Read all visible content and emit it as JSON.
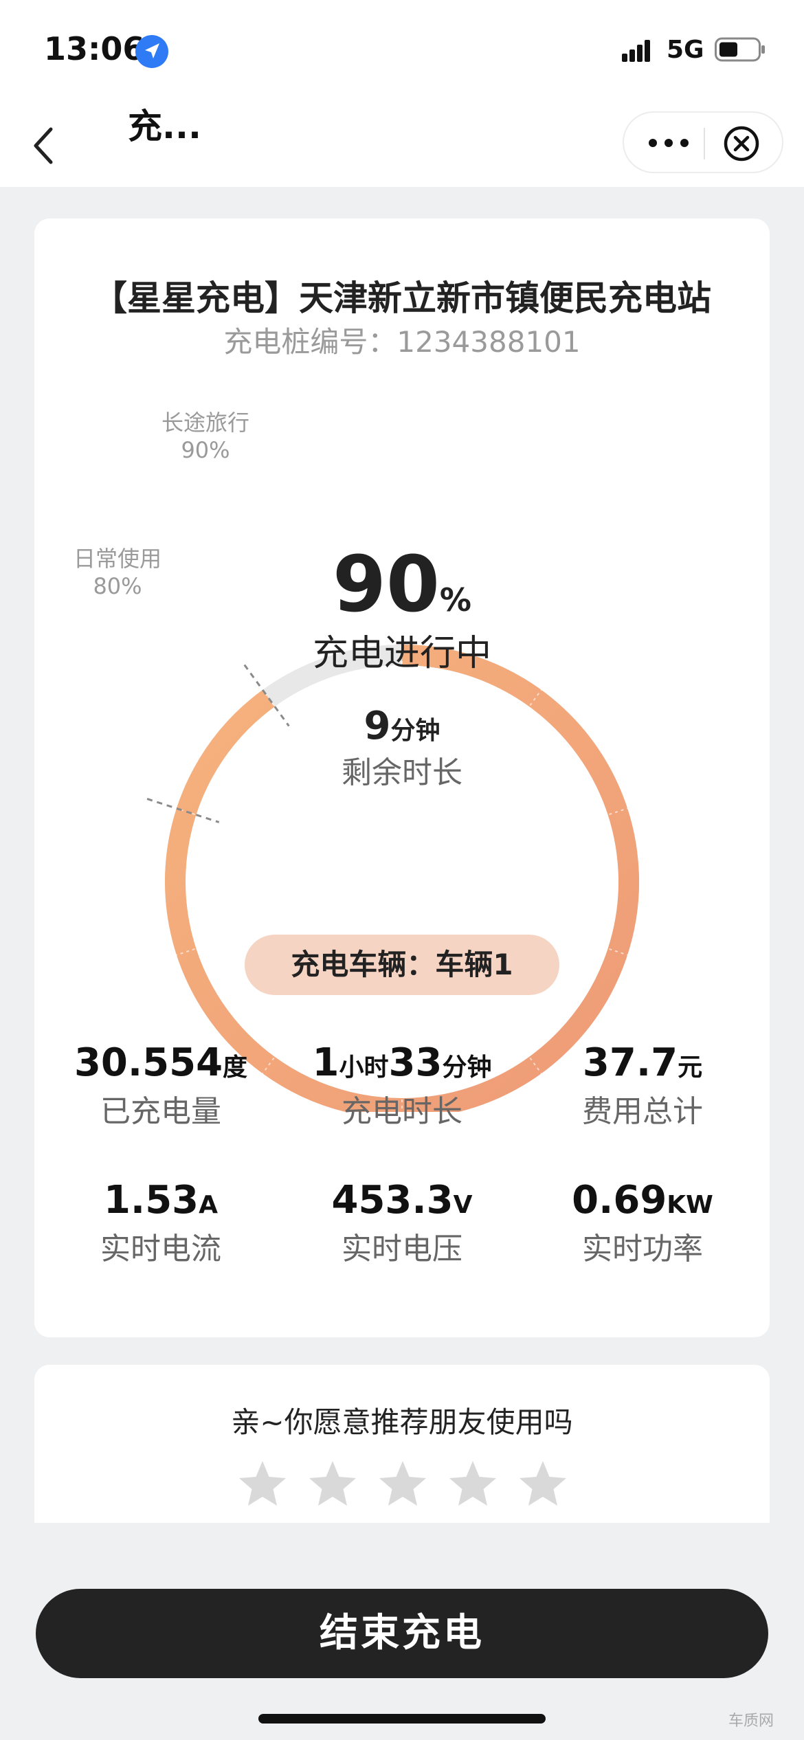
{
  "status_bar": {
    "time": "13:06",
    "network": "5G"
  },
  "nav": {
    "title": "充..."
  },
  "station": {
    "name": "【星星充电】天津新立新市镇便民充电站",
    "pile_label": "充电桩编号：",
    "pile_number": "1234388101"
  },
  "gauge": {
    "percent": 90,
    "percent_text": "90",
    "percent_unit": "%",
    "status": "充电进行中",
    "remaining_value": "9",
    "remaining_unit": "分钟",
    "remaining_label": "剩余时长",
    "marks": [
      {
        "label": "长途旅行",
        "value": "90%"
      },
      {
        "label": "日常使用",
        "value": "80%"
      }
    ]
  },
  "vehicle": {
    "label": "充电车辆：车辆1"
  },
  "stats": {
    "energy": {
      "value": "30.554",
      "unit": "度",
      "label": "已充电量"
    },
    "duration": {
      "hours": "1",
      "hours_unit": "小时",
      "minutes": "33",
      "minutes_unit": "分钟",
      "label": "充电时长"
    },
    "cost": {
      "value": "37.7",
      "unit": "元",
      "label": "费用总计"
    },
    "current": {
      "value": "1.53",
      "unit": "A",
      "label": "实时电流"
    },
    "voltage": {
      "value": "453.3",
      "unit": "V",
      "label": "实时电压"
    },
    "power": {
      "value": "0.69",
      "unit": "KW",
      "label": "实时功率"
    }
  },
  "rating": {
    "question": "亲~你愿意推荐朋友使用吗",
    "star_count": 5,
    "selected": 0
  },
  "actions": {
    "end_label": "结束充电"
  },
  "watermark": "车质网",
  "colors": {
    "accent": "#f0a274",
    "button": "#232323",
    "pill": "#f6d4c4"
  }
}
